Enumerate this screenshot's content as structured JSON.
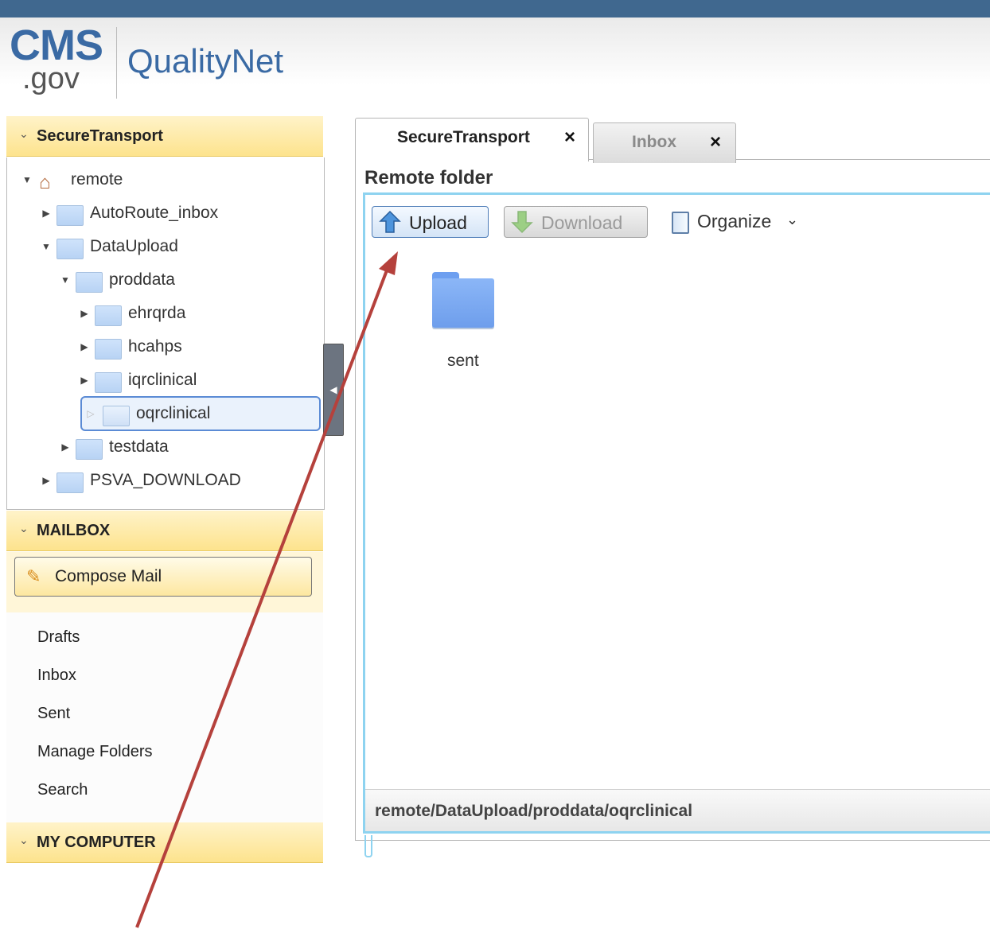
{
  "header": {
    "logo_cms": "CMS",
    "logo_gov": ".gov",
    "logo_quality": "QualityNet"
  },
  "left_panel": {
    "securetransport_title": "SecureTransport",
    "tree": {
      "root": "remote",
      "items": [
        "AutoRoute_inbox",
        "DataUpload",
        "proddata",
        "ehrqrda",
        "hcahps",
        "iqrclinical",
        "oqrclinical",
        "testdata",
        "PSVA_DOWNLOAD"
      ]
    },
    "mailbox_title": "MAILBOX",
    "compose_label": "Compose Mail",
    "mail_items": [
      "Drafts",
      "Inbox",
      "Sent",
      "Manage Folders",
      "Search"
    ],
    "mycomputer_title": "MY COMPUTER"
  },
  "tabs": [
    {
      "label": "SecureTransport",
      "close": "×"
    },
    {
      "label": "Inbox",
      "close": "×"
    }
  ],
  "main": {
    "title": "Remote folder",
    "toolbar": {
      "upload_label": "Upload",
      "download_label": "Download",
      "organize_label": "Organize"
    },
    "folders": [
      "sent"
    ],
    "path": "remote/DataUpload/proddata/oqrclinical"
  },
  "colors": {
    "brand_blue": "#40688f",
    "accordion_yellow": "#fde38d",
    "selection_border": "#5b8bd5",
    "frame_cyan": "#8ed3f0",
    "annotation_arrow": "#b5413c"
  },
  "icons": [
    "home-icon",
    "folder-icon",
    "pencil-icon",
    "upload-arrow-icon",
    "download-arrow-icon",
    "book-icon",
    "chevron-down-icon",
    "close-icon"
  ]
}
